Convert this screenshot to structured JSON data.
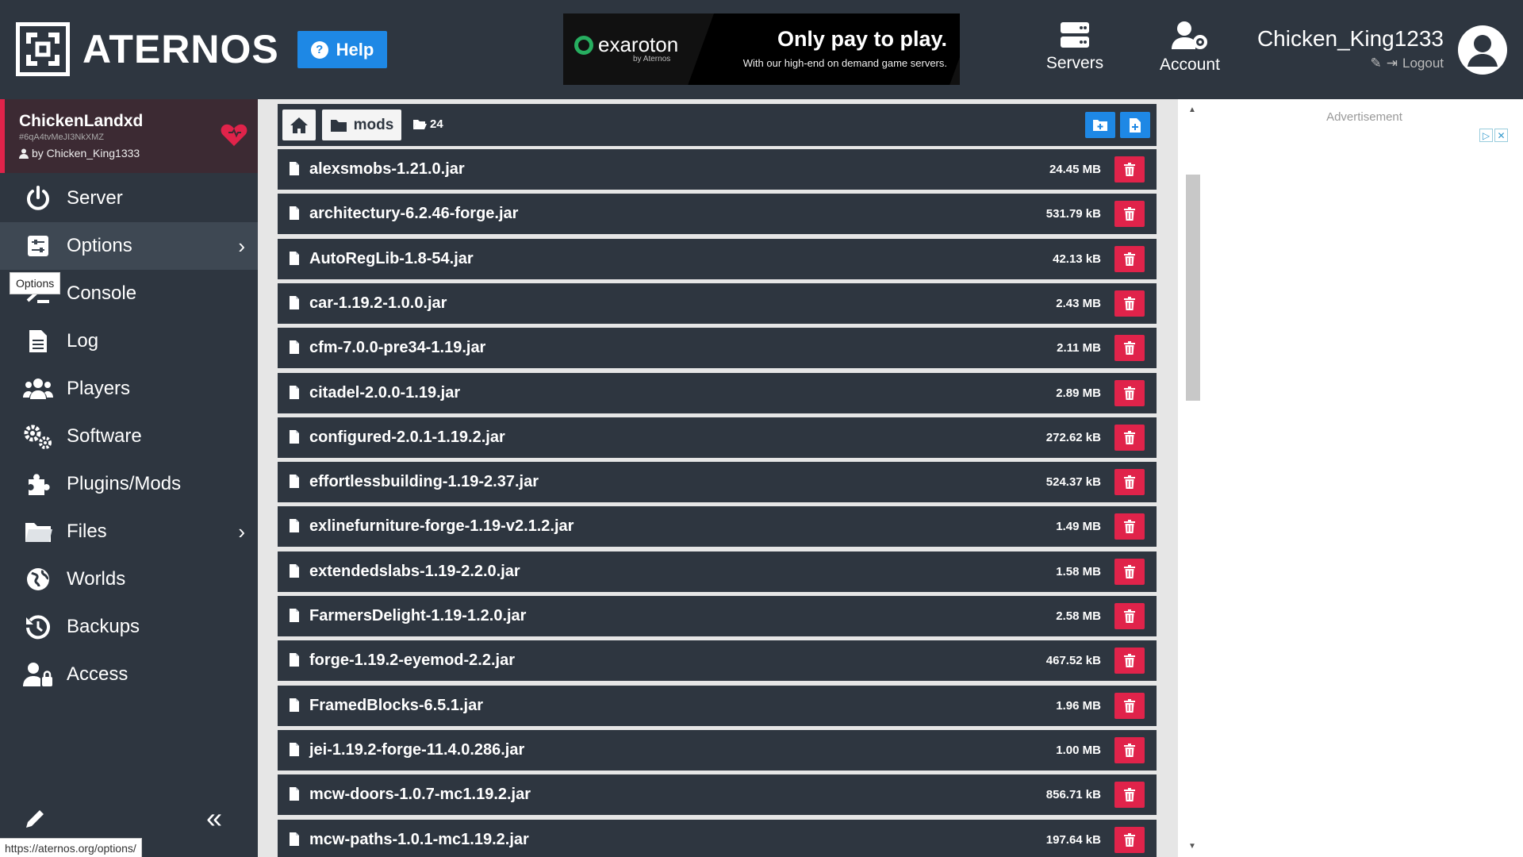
{
  "header": {
    "logo_text": "ATERNOS",
    "help_label": "Help",
    "ad": {
      "brand": "exaroton",
      "brand_sub": "by Aternos",
      "title": "Only pay to play.",
      "subtitle": "With our high-end on demand game servers."
    },
    "nav": {
      "servers_label": "Servers",
      "account_label": "Account"
    },
    "user": {
      "username": "Chicken_King1233",
      "logout_label": "Logout"
    }
  },
  "sidebar": {
    "server": {
      "name": "ChickenLandxd",
      "id": "#6qA4tvMeJI3NkXMZ",
      "owner": "by Chicken_King1333"
    },
    "items": [
      {
        "label": "Server",
        "icon": "power-icon"
      },
      {
        "label": "Options",
        "icon": "sliders-icon",
        "active": true
      },
      {
        "label": "Console",
        "icon": "terminal-icon"
      },
      {
        "label": "Log",
        "icon": "document-icon"
      },
      {
        "label": "Players",
        "icon": "users-icon"
      },
      {
        "label": "Software",
        "icon": "gears-icon"
      },
      {
        "label": "Plugins/Mods",
        "icon": "puzzle-icon"
      },
      {
        "label": "Files",
        "icon": "folder-icon"
      },
      {
        "label": "Worlds",
        "icon": "globe-icon"
      },
      {
        "label": "Backups",
        "icon": "history-icon"
      },
      {
        "label": "Access",
        "icon": "user-lock-icon"
      }
    ],
    "tooltip": "Options",
    "status_url": "https://aternos.org/options/"
  },
  "files": {
    "breadcrumb_folder": "mods",
    "file_count": "24",
    "rows": [
      {
        "name": "alexsmobs-1.21.0.jar",
        "size": "24.45 MB"
      },
      {
        "name": "architectury-6.2.46-forge.jar",
        "size": "531.79 kB"
      },
      {
        "name": "AutoRegLib-1.8-54.jar",
        "size": "42.13 kB"
      },
      {
        "name": "car-1.19.2-1.0.0.jar",
        "size": "2.43 MB"
      },
      {
        "name": "cfm-7.0.0-pre34-1.19.jar",
        "size": "2.11 MB"
      },
      {
        "name": "citadel-2.0.0-1.19.jar",
        "size": "2.89 MB"
      },
      {
        "name": "configured-2.0.1-1.19.2.jar",
        "size": "272.62 kB"
      },
      {
        "name": "effortlessbuilding-1.19-2.37.jar",
        "size": "524.37 kB"
      },
      {
        "name": "exlinefurniture-forge-1.19-v2.1.2.jar",
        "size": "1.49 MB"
      },
      {
        "name": "extendedslabs-1.19-2.2.0.jar",
        "size": "1.58 MB"
      },
      {
        "name": "FarmersDelight-1.19-1.2.0.jar",
        "size": "2.58 MB"
      },
      {
        "name": "forge-1.19.2-eyemod-2.2.jar",
        "size": "467.52 kB"
      },
      {
        "name": "FramedBlocks-6.5.1.jar",
        "size": "1.96 MB"
      },
      {
        "name": "jei-1.19.2-forge-11.4.0.286.jar",
        "size": "1.00 MB"
      },
      {
        "name": "mcw-doors-1.0.7-mc1.19.2.jar",
        "size": "856.71 kB"
      },
      {
        "name": "mcw-paths-1.0.1-mc1.19.2.jar",
        "size": "197.64 kB"
      }
    ]
  },
  "right_ad": {
    "label": "Advertisement"
  },
  "colors": {
    "dark_bg": "#2e3640",
    "accent_blue": "#1e88e5",
    "delete_red": "#e0234a"
  }
}
